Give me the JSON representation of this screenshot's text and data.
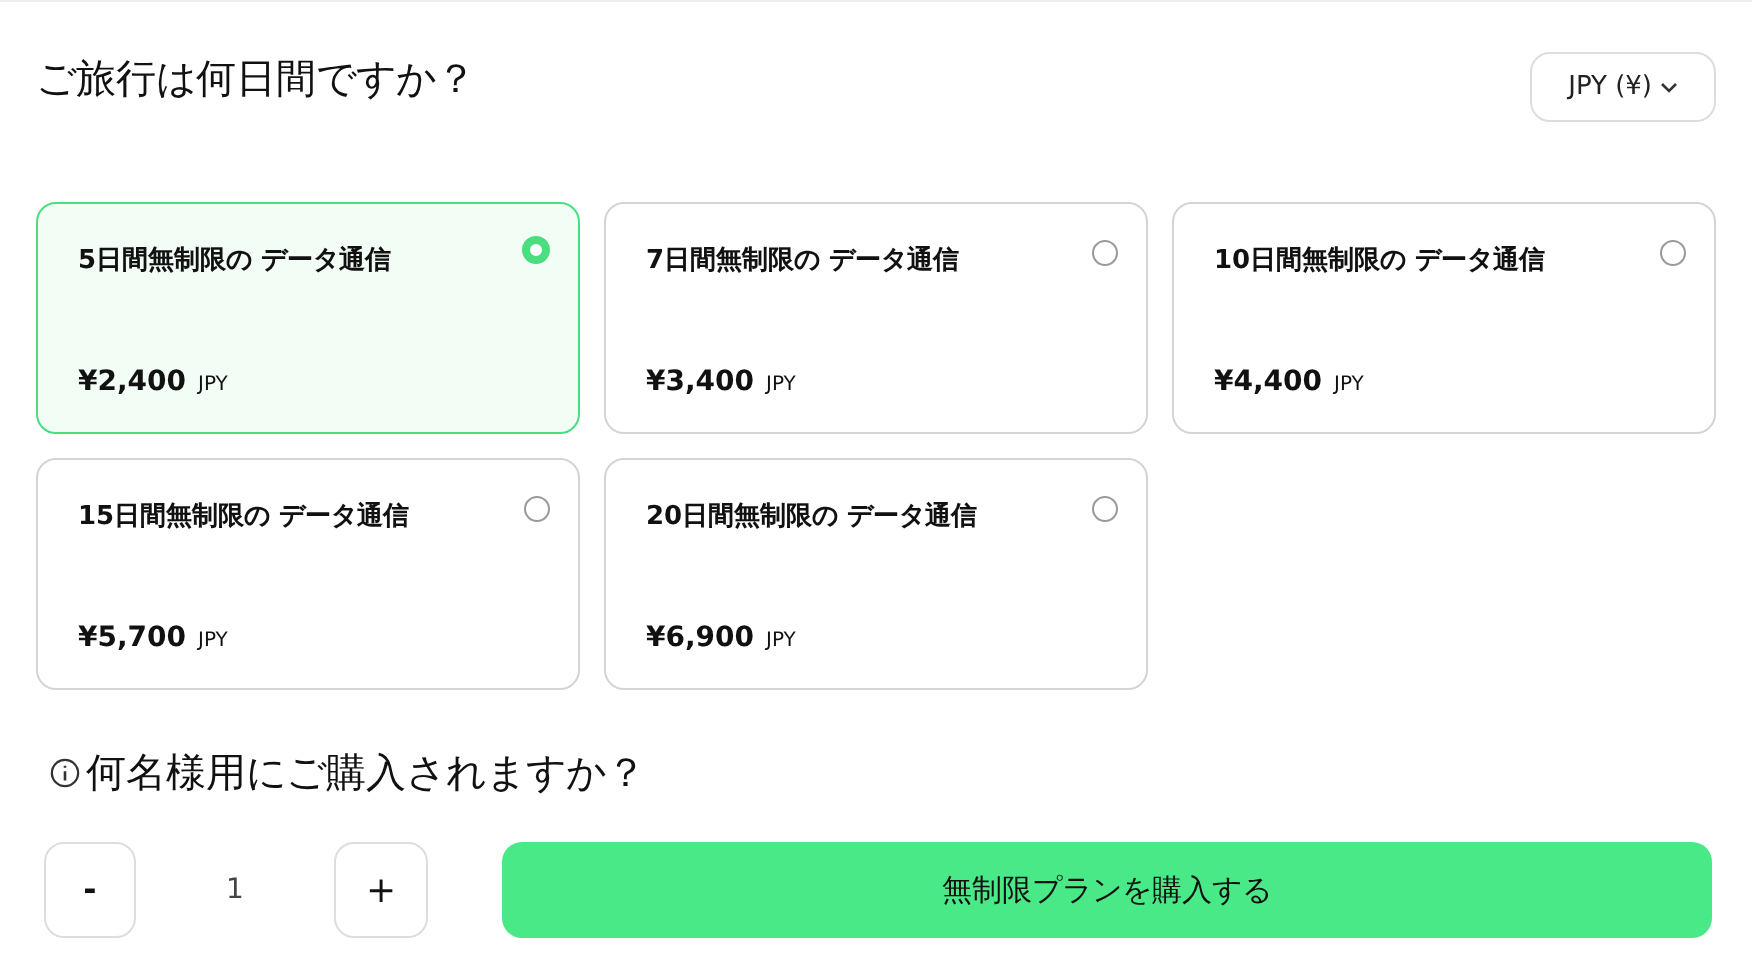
{
  "heading": "ご旅行は何日間ですか？",
  "currency": {
    "label": "JPY (¥)"
  },
  "plans": [
    {
      "title": "5日間無制限の データ通信",
      "price": "¥2,400",
      "unit": "JPY",
      "selected": true
    },
    {
      "title": "7日間無制限の データ通信",
      "price": "¥3,400",
      "unit": "JPY",
      "selected": false
    },
    {
      "title": "10日間無制限の データ通信",
      "price": "¥4,400",
      "unit": "JPY",
      "selected": false
    },
    {
      "title": "15日間無制限の データ通信",
      "price": "¥5,700",
      "unit": "JPY",
      "selected": false
    },
    {
      "title": "20日間無制限の データ通信",
      "price": "¥6,900",
      "unit": "JPY",
      "selected": false
    }
  ],
  "quantity": {
    "heading": "何名様用にご購入されますか？",
    "minus": "-",
    "value": "1",
    "plus": "+"
  },
  "buy_button": "無制限プランを購入する"
}
